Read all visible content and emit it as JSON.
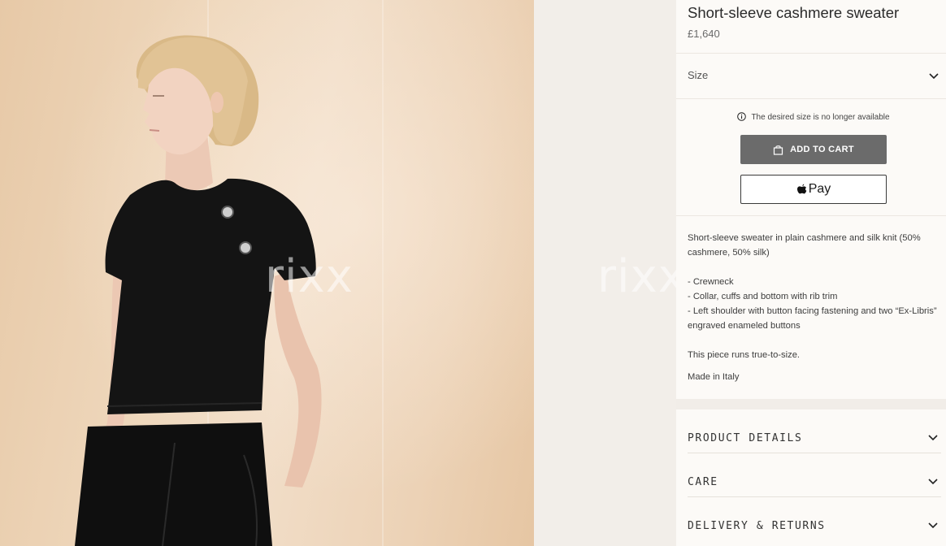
{
  "watermark": "rixx",
  "product": {
    "title": "Short-sleeve cashmere sweater",
    "price": "£1,640"
  },
  "size_selector": {
    "label": "Size"
  },
  "availability_message": "The desired size is no longer available",
  "buttons": {
    "add_to_cart": "ADD TO CART",
    "apple_pay": "Pay"
  },
  "description": {
    "intro": "Short-sleeve sweater in plain cashmere and silk knit (50% cashmere, 50% silk)",
    "features": [
      "- Crewneck",
      "- Collar, cuffs and bottom with rib trim",
      "- Left shoulder with button facing fastening and two “Ex-Libris” engraved enameled buttons"
    ],
    "fit_note": "This piece runs true-to-size.",
    "origin": "Made in Italy"
  },
  "accordion": [
    {
      "label": "PRODUCT DETAILS"
    },
    {
      "label": "CARE"
    },
    {
      "label": "DELIVERY & RETURNS"
    }
  ],
  "colors": {
    "panel_background": "#fcfaf7",
    "page_background": "#f1ede8",
    "cart_button": "#6b6b6b",
    "photo_backdrop": "#efd8bd"
  },
  "icons": {
    "availability": "info-icon",
    "cart": "shopping-bag-icon",
    "pay": "apple-logo-icon",
    "expand": "chevron-down-icon"
  }
}
